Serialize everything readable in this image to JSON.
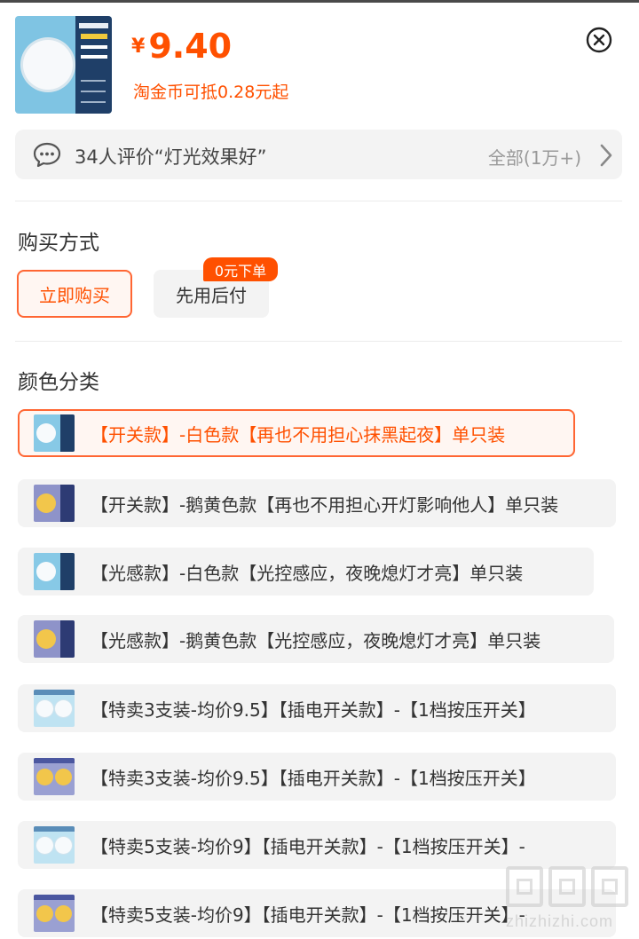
{
  "product": {
    "currency_symbol": "¥",
    "price": "9.40",
    "coin_discount": "淘金币可抵0.28元起"
  },
  "review": {
    "summary": "34人评价“灯光效果好”",
    "all_label": "全部(1万+)"
  },
  "purchase": {
    "title": "购买方式",
    "buy_now": "立即购买",
    "pay_later": "先用后付",
    "pay_later_badge": "0元下单"
  },
  "colors": {
    "title": "颜色分类",
    "options": [
      {
        "label": "【开关款】-白色款【再也不用担心抹黑起夜】单只装",
        "selected": true,
        "image": "white"
      },
      {
        "label": "【开关款】-鹅黄色款【再也不用担心开灯影响他人】单只装",
        "selected": false,
        "image": "yellow"
      },
      {
        "label": "【光感款】-白色款【光控感应，夜晚熄灯才亮】单只装",
        "selected": false,
        "image": "white"
      },
      {
        "label": "【光感款】-鹅黄色款【光控感应，夜晚熄灯才亮】单只装",
        "selected": false,
        "image": "yellow"
      },
      {
        "label": "【特卖3支装-均价9.5】【插电开关款】-【1档按压开关】",
        "selected": false,
        "image": "white-multi"
      },
      {
        "label": "【特卖3支装-均价9.5】【插电开关款】-【1档按压开关】",
        "selected": false,
        "image": "yellow-multi"
      },
      {
        "label": "【特卖5支装-均价9】【插电开关款】-【1档按压开关】-",
        "selected": false,
        "image": "white-multi"
      },
      {
        "label": "【特卖5支装-均价9】【插电开关款】-【1档按压开关】-",
        "selected": false,
        "image": "yellow-multi"
      }
    ]
  },
  "watermark": {
    "text": "zhizhizhi.com"
  },
  "icons": {
    "close": "close-icon",
    "review": "chat-bubble-icon",
    "chevron": "chevron-right-icon"
  },
  "accent_color": "#ff5000"
}
